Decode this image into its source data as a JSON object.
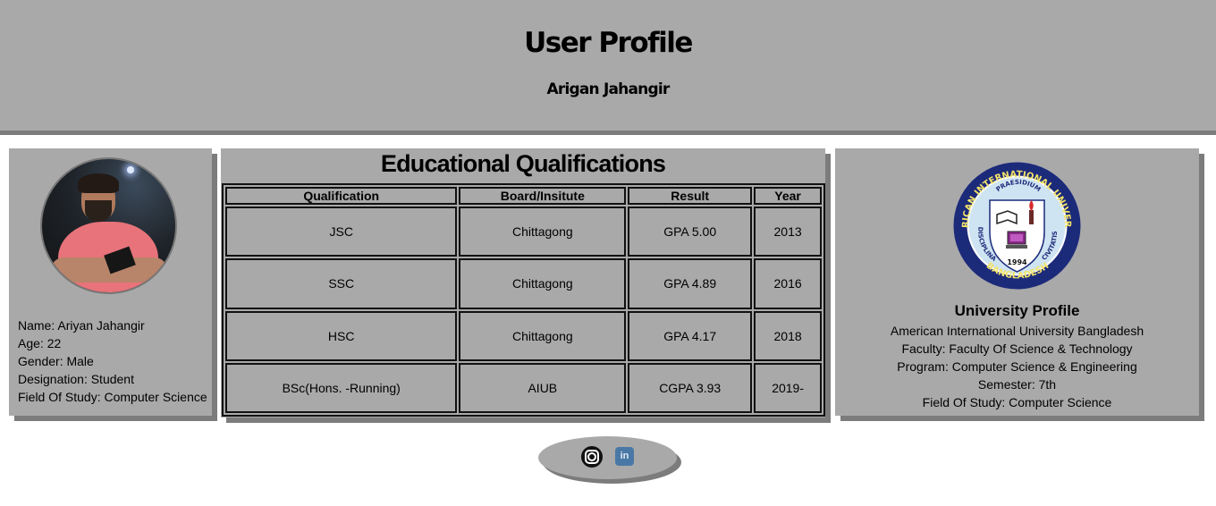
{
  "header": {
    "title": "User Profile",
    "subtitle": "Arigan Jahangir"
  },
  "profile": {
    "avatar_icon": "user-photo",
    "lines": [
      "Name: Ariyan Jahangir",
      "Age: 22",
      "Gender: Male",
      "Designation: Student",
      "Field Of Study: Computer Science"
    ]
  },
  "education": {
    "title": "Educational Qualifications",
    "columns": [
      "Qualification",
      "Board/Insitute",
      "Result",
      "Year"
    ],
    "rows": [
      [
        "JSC",
        "Chittagong",
        "GPA 5.00",
        "2013"
      ],
      [
        "SSC",
        "Chittagong",
        "GPA 4.89",
        "2016"
      ],
      [
        "HSC",
        "Chittagong",
        "GPA 4.17",
        "2018"
      ],
      [
        "BSc(Hons. -Running)",
        "AIUB",
        "CGPA 3.93",
        "2019-"
      ]
    ]
  },
  "university": {
    "logo": {
      "top_text": "AMERICAN INTERNATIONAL UNIVERSITY",
      "motto_top": "PRAESIDIUM",
      "left_text": "DISCIPLINA",
      "right_text": "CIVITATIS",
      "year": "1994",
      "bottom_text": "BANGLADESH"
    },
    "heading": "University Profile",
    "lines": [
      "American International University Bangladesh",
      "Faculty: Faculty Of Science & Technology",
      "Program: Computer Science & Engineering",
      "Semester: 7th",
      "Field Of Study: Computer Science"
    ]
  },
  "social": {
    "instagram_icon": "instagram-icon",
    "linkedin_icon": "linkedin-icon",
    "linkedin_text": "in"
  },
  "colors": {
    "panel": "#a9a9a9",
    "shadow": "#7c7c7c",
    "logo_blue": "#1c2a7a",
    "logo_inner": "#cfe4f2"
  }
}
